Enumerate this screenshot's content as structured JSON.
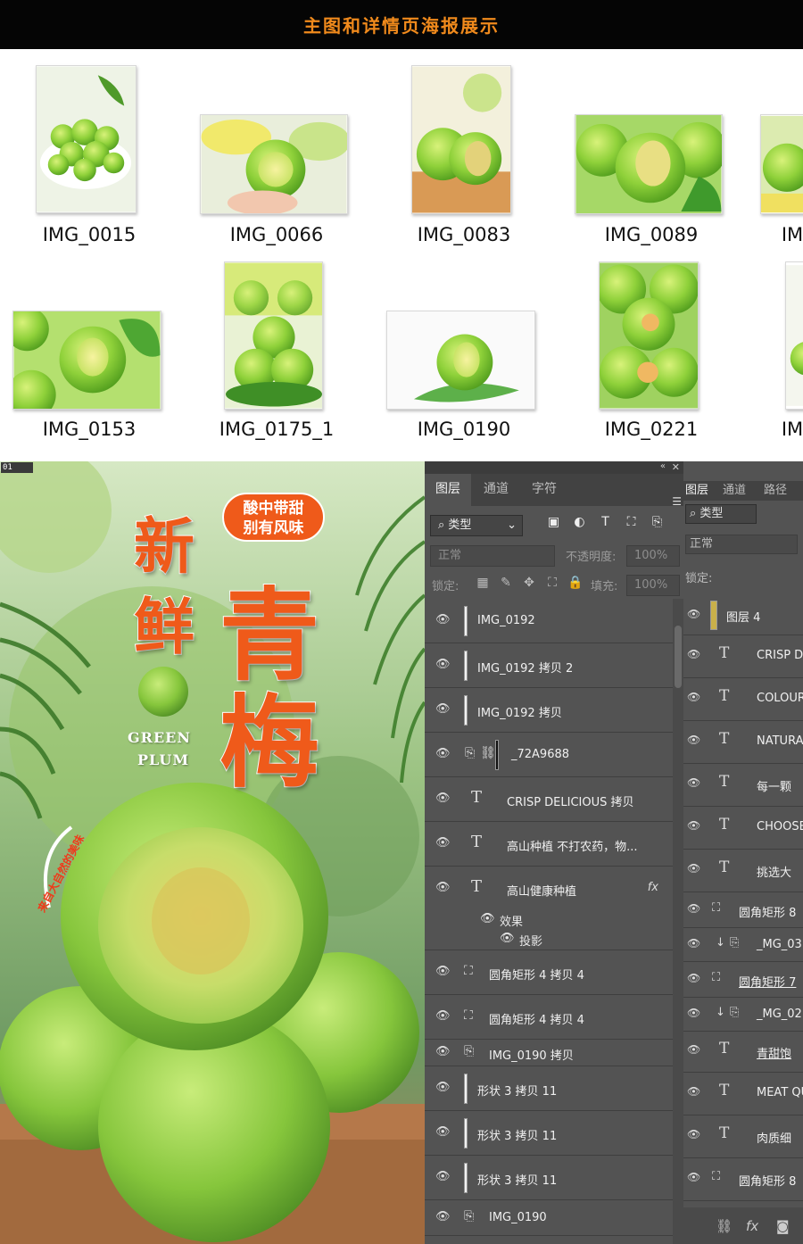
{
  "header": {
    "title": "主图和详情页海报展示"
  },
  "explorer": {
    "files": [
      {
        "name": "IMG_0015"
      },
      {
        "name": "IMG_0066"
      },
      {
        "name": "IMG_0083"
      },
      {
        "name": "IMG_0089"
      },
      {
        "name": "IM"
      },
      {
        "name": "IMG_0153"
      },
      {
        "name": "IMG_0175_1"
      },
      {
        "name": "IMG_0190"
      },
      {
        "name": "IMG_0221"
      },
      {
        "name": "IM"
      }
    ]
  },
  "poster": {
    "doc_tab": "01",
    "title_small": [
      "新",
      "鲜"
    ],
    "title_big": [
      "青",
      "梅"
    ],
    "tag_lines": [
      "酸中带甜",
      "别有风味"
    ],
    "english": [
      "GREEN",
      "PLUM"
    ],
    "curve_text": "来自大自然的美味"
  },
  "layers_panel": {
    "tabs": [
      "图层",
      "通道",
      "字符"
    ],
    "filter_label": "类型",
    "blend_mode": "正常",
    "opacity_label": "不透明度:",
    "opacity_value": "100%",
    "lock_label": "锁定:",
    "fill_label": "填充:",
    "fill_value": "100%",
    "layers": [
      {
        "name": "IMG_0192",
        "type": "image"
      },
      {
        "name": "IMG_0192 拷贝 2",
        "type": "image"
      },
      {
        "name": "IMG_0192 拷贝",
        "type": "image"
      },
      {
        "name": "_72A9688",
        "type": "smart-linked"
      },
      {
        "name": "CRISP DELICIOUS 拷贝",
        "type": "text"
      },
      {
        "name": "高山种植 不打农药，物...",
        "type": "text"
      },
      {
        "name": "高山健康种植",
        "type": "text",
        "fx": "fx",
        "effects_label": "效果",
        "effect": "投影"
      },
      {
        "name": "圆角矩形 4 拷贝 4",
        "type": "shape"
      },
      {
        "name": "圆角矩形 4 拷贝 4",
        "type": "shape"
      },
      {
        "name": "IMG_0190 拷贝",
        "type": "smart"
      },
      {
        "name": "形状 3 拷贝 11",
        "type": "image"
      },
      {
        "name": "形状 3 拷贝 11",
        "type": "image"
      },
      {
        "name": "形状 3 拷贝 11",
        "type": "image"
      },
      {
        "name": "IMG_0190",
        "type": "smart"
      }
    ]
  },
  "second_panel": {
    "tabs": [
      "图层",
      "通道",
      "路径"
    ],
    "filter_label": "类型",
    "blend_mode": "正常",
    "lock_label": "锁定:",
    "layers": [
      {
        "name": "图层 4",
        "type": "image"
      },
      {
        "name": "CRISP D",
        "type": "text"
      },
      {
        "name": "COLOUR",
        "type": "text"
      },
      {
        "name": "NATURA",
        "type": "text"
      },
      {
        "name": "每一颗",
        "type": "text"
      },
      {
        "name": "CHOOSE",
        "type": "text"
      },
      {
        "name": "挑选大",
        "type": "text"
      },
      {
        "name": "圆角矩形 8",
        "type": "shape"
      },
      {
        "name": "_MG_03",
        "type": "smart"
      },
      {
        "name": "圆角矩形 7",
        "type": "shape"
      },
      {
        "name": "_MG_02",
        "type": "smart"
      },
      {
        "name": "青甜饱",
        "type": "text"
      },
      {
        "name": "MEAT QU",
        "type": "text"
      },
      {
        "name": "肉质细",
        "type": "text"
      },
      {
        "name": "圆角矩形 8",
        "type": "shape"
      }
    ]
  }
}
